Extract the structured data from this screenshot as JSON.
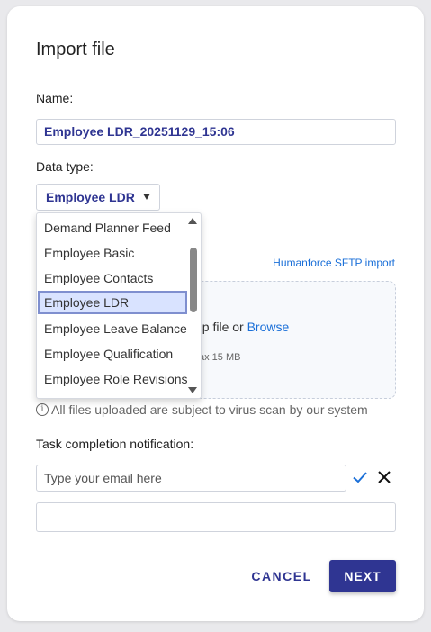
{
  "dialog": {
    "title": "Import file",
    "name_label": "Name:",
    "name_value": "Employee LDR_20251129_15:06",
    "data_type_label": "Data type:",
    "data_type_value": "Employee LDR",
    "sftp_link": "Humanforce SFTP import",
    "dropzone_text_partial": "op file or ",
    "browse_link": "Browse",
    "dropzone_size_partial": "ax 15 MB",
    "virus_note": "All files uploaded are subject to virus scan by our system",
    "notification_label": "Task completion notification:",
    "email_placeholder": "Type your email here",
    "cancel_label": "CANCEL",
    "next_label": "NEXT"
  },
  "dropdown": {
    "items": [
      "Demand Planner Feed",
      "Employee Basic",
      "Employee Contacts",
      "Employee LDR",
      "Employee Leave Balance",
      "Employee Qualification",
      "Employee Role Revisions"
    ],
    "selected_index": 3
  },
  "colors": {
    "accent": "#2f3592",
    "link": "#1a6fd8",
    "selected_bg": "#d9e3ff"
  },
  "icons": [
    "info-icon",
    "check-icon",
    "close-icon",
    "chevron-down-icon",
    "scroll-up-icon",
    "scroll-down-icon"
  ]
}
